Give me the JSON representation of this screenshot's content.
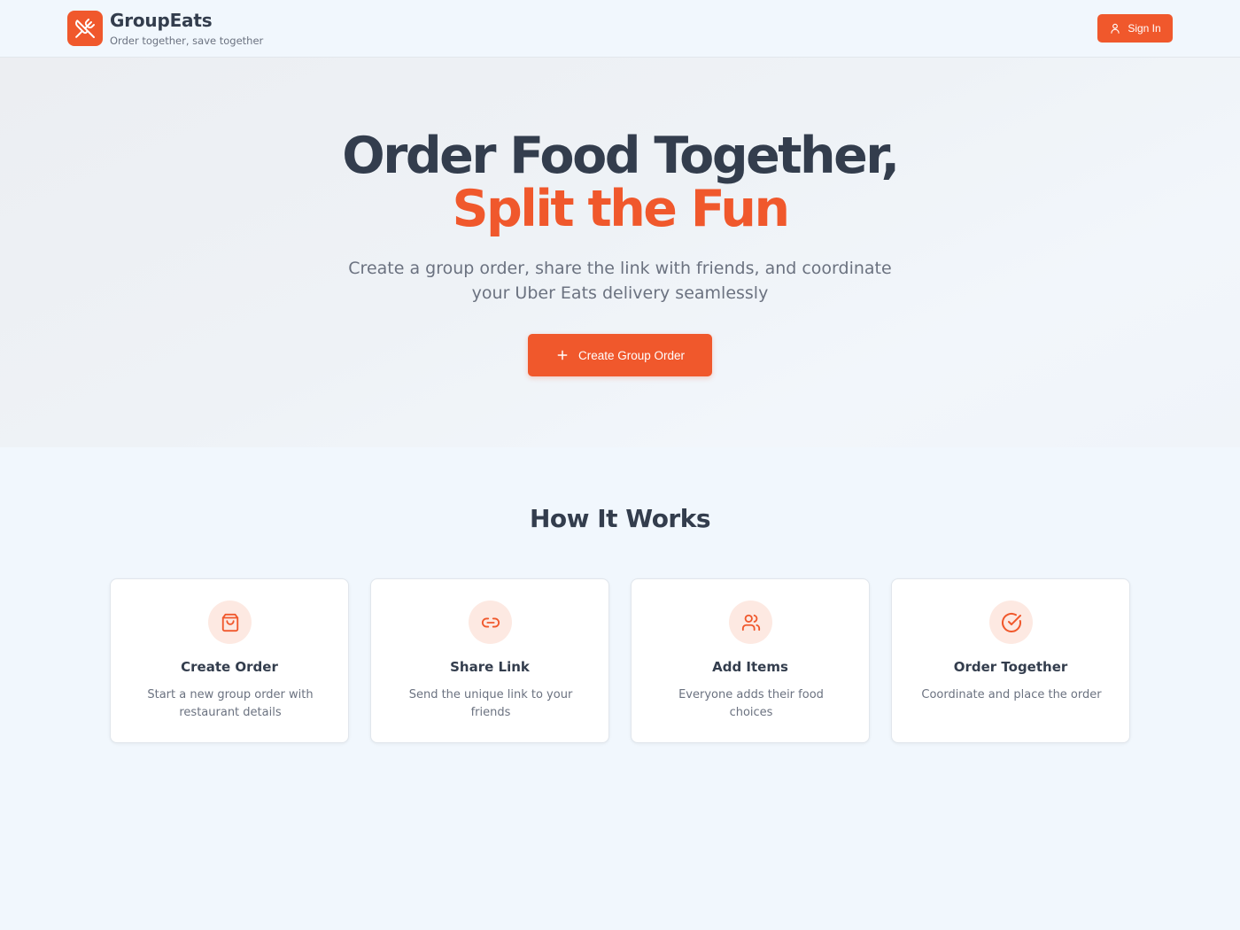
{
  "header": {
    "brand_name": "GroupEats",
    "tagline": "Order together, save together",
    "logo_icon": "utensils-crossed-icon",
    "signin_label": "Sign In",
    "signin_icon": "user-icon"
  },
  "hero": {
    "title_line1": "Order Food Together,",
    "title_line2": "Split the Fun",
    "subtitle": "Create a group order, share the link with friends, and coordinate your Uber Eats delivery seamlessly",
    "cta_label": "Create Group Order",
    "cta_icon": "plus-icon"
  },
  "how_it_works": {
    "title": "How It Works",
    "steps": [
      {
        "title": "Create Order",
        "description": "Start a new group order with restaurant details",
        "icon": "shopping-bag-icon"
      },
      {
        "title": "Share Link",
        "description": "Send the unique link to your friends",
        "icon": "link-icon"
      },
      {
        "title": "Add Items",
        "description": "Everyone adds their food choices",
        "icon": "users-icon"
      },
      {
        "title": "Order Together",
        "description": "Coordinate and place the order",
        "icon": "check-circle-icon"
      }
    ]
  },
  "colors": {
    "accent": "#f0582c",
    "accent_soft": "#fde9e2",
    "text_dark": "#333d4d",
    "text_muted": "#6b7280",
    "background": "#f1f7fd"
  }
}
